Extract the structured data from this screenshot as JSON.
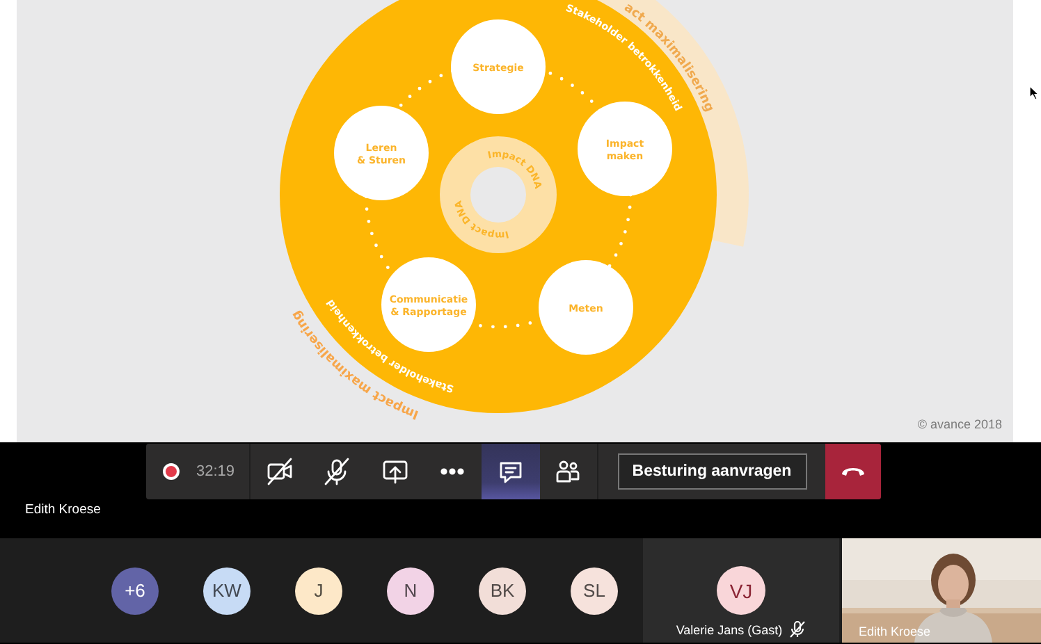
{
  "slide": {
    "diagram": {
      "arc_labels": [
        "act maximalisering",
        "Stakeholder betrokkenheid",
        "Stakeholder betrokkenheid",
        "Impact maximalisering"
      ],
      "center_labels": [
        "Impact DNA",
        "Impact DNA"
      ],
      "nodes": [
        {
          "lines": [
            "Strategie"
          ]
        },
        {
          "lines": [
            "Impact",
            "maken"
          ]
        },
        {
          "lines": [
            "Meten"
          ]
        },
        {
          "lines": [
            "Communicatie",
            "& Rapportage"
          ]
        },
        {
          "lines": [
            "Leren",
            "& Sturen"
          ]
        }
      ]
    },
    "copyright": "© avance 2018"
  },
  "call_toolbar": {
    "recording": true,
    "timer": "32:19",
    "tools": [
      {
        "kind": "camera",
        "off": true,
        "selected": false
      },
      {
        "kind": "mic",
        "off": true,
        "selected": false
      },
      {
        "kind": "share",
        "off": false,
        "selected": false
      },
      {
        "kind": "more",
        "off": false,
        "selected": false
      },
      {
        "kind": "chat",
        "off": false,
        "selected": true
      },
      {
        "kind": "people",
        "off": false,
        "selected": false
      }
    ],
    "control_button": "Besturing aanvragen"
  },
  "presenter_name": "Edith Kroese",
  "participants": [
    {
      "initials": "+6",
      "color": "#6264a7"
    },
    {
      "initials": "KW",
      "color": "#c7dbf5"
    },
    {
      "initials": "J",
      "color": "#fde8c8"
    },
    {
      "initials": "N",
      "color": "#f2d3e6"
    },
    {
      "initials": "BK",
      "color": "#f2ded8"
    },
    {
      "initials": "SL",
      "color": "#f6e2dc"
    }
  ],
  "active_tiles": [
    {
      "kind": "avatar",
      "initials": "VJ",
      "color": "#f9d6d9",
      "name": "Valerie Jans (Gast)",
      "muted": true
    },
    {
      "kind": "video",
      "name": "Edith Kroese",
      "muted": false
    }
  ]
}
